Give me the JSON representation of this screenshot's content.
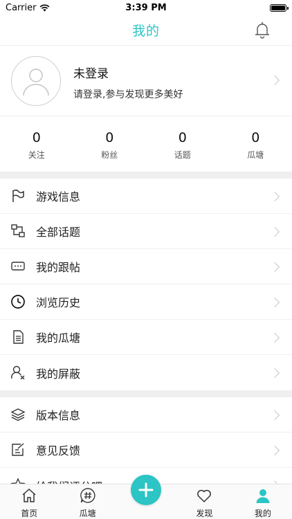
{
  "status_bar": {
    "carrier": "Carrier",
    "time": "3:39 PM"
  },
  "nav": {
    "title": "我的"
  },
  "profile": {
    "name": "未登录",
    "hint": "请登录,参与发现更多美好"
  },
  "stats": [
    {
      "value": "0",
      "label": "关注"
    },
    {
      "value": "0",
      "label": "粉丝"
    },
    {
      "value": "0",
      "label": "话题"
    },
    {
      "value": "0",
      "label": "瓜塘"
    }
  ],
  "menu_group1": [
    {
      "label": "游戏信息",
      "icon": "flag-icon"
    },
    {
      "label": "全部话题",
      "icon": "topics-icon"
    },
    {
      "label": "我的跟帖",
      "icon": "comments-icon"
    },
    {
      "label": "浏览历史",
      "icon": "clock-icon"
    },
    {
      "label": "我的瓜塘",
      "icon": "document-icon"
    },
    {
      "label": "我的屏蔽",
      "icon": "user-block-icon"
    }
  ],
  "menu_group2": [
    {
      "label": "版本信息",
      "icon": "layers-icon"
    },
    {
      "label": "意见反馈",
      "icon": "feedback-icon"
    },
    {
      "label": "给我们评分吧",
      "icon": "star-icon"
    }
  ],
  "tabbar": {
    "items": [
      {
        "label": "首页",
        "icon": "home-icon"
      },
      {
        "label": "瓜塘",
        "icon": "hashtag-icon"
      },
      {
        "label": "",
        "icon": "plus-icon"
      },
      {
        "label": "发现",
        "icon": "heart-icon"
      },
      {
        "label": "我的",
        "icon": "person-icon"
      }
    ],
    "active": "我的",
    "accent": "#2cc4c4"
  }
}
